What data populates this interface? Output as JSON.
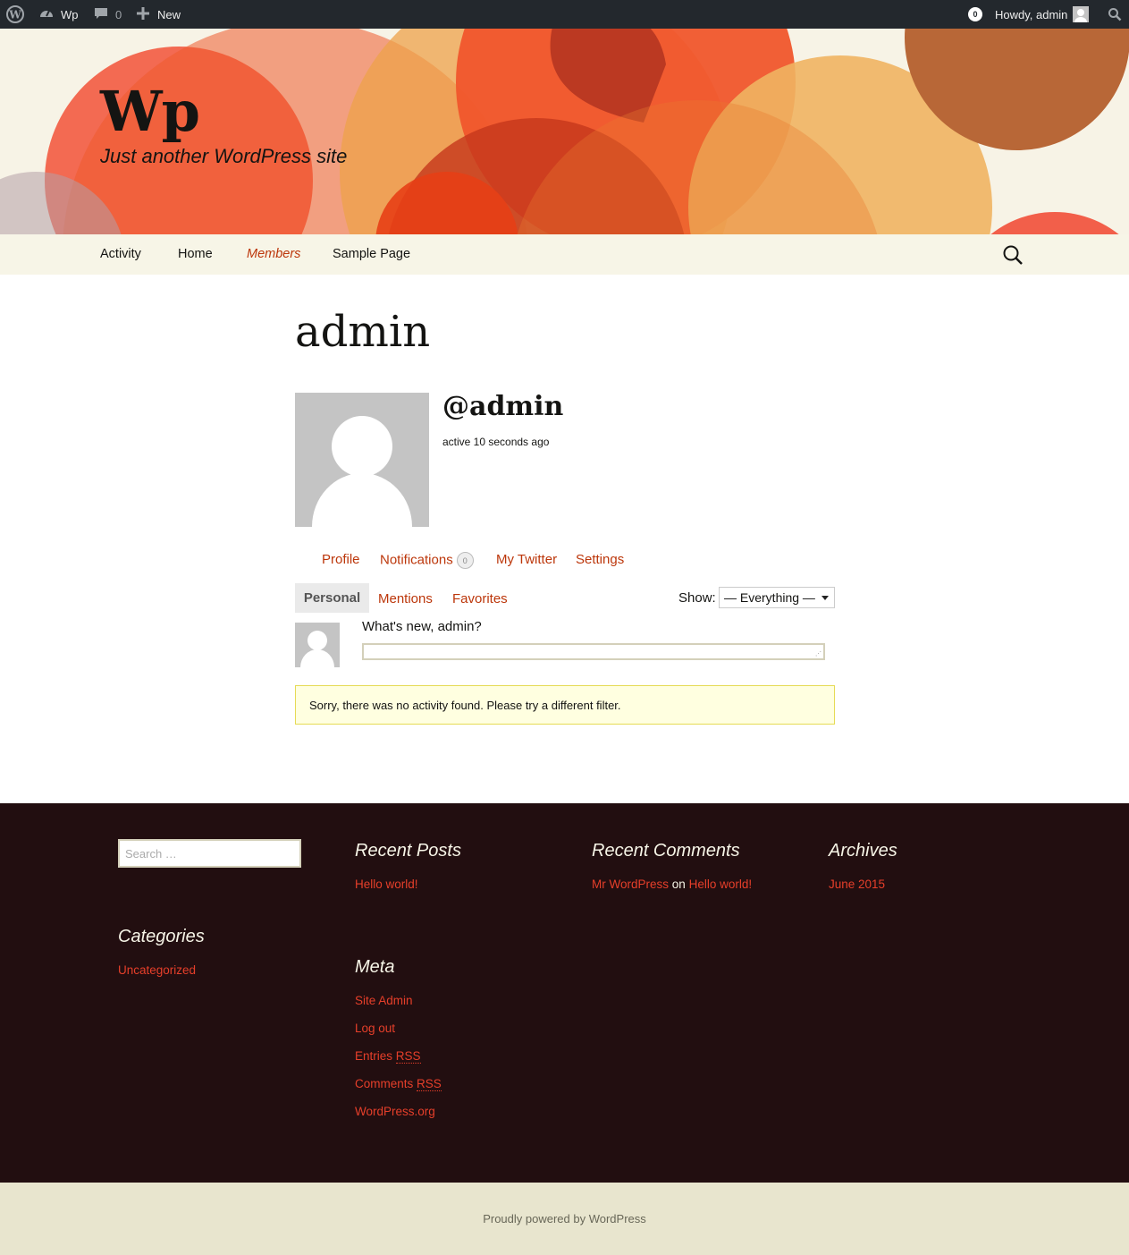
{
  "admin_bar": {
    "site_name": "Wp",
    "comments_count": "0",
    "new_label": "New",
    "notifications_count": "0",
    "howdy": "Howdy, admin",
    "icons": [
      "wordpress-logo-icon",
      "dashboard-icon",
      "comment-icon",
      "plus-icon",
      "user-avatar-icon",
      "search-icon"
    ]
  },
  "header": {
    "site_title": "Wp",
    "tagline": "Just another WordPress site"
  },
  "nav": {
    "items": [
      "Activity",
      "Home",
      "Members",
      "Sample Page"
    ],
    "current": "Members"
  },
  "profile": {
    "page_title": "admin",
    "mention": "@admin",
    "last_active": "active 10 seconds ago",
    "tabs": [
      "Profile",
      "Notifications",
      "My Twitter",
      "Settings"
    ],
    "notifications_count": "0",
    "subtabs": [
      "Personal",
      "Mentions",
      "Favorites"
    ],
    "show_label": "Show:",
    "show_value": "— Everything —",
    "whats_new": "What's new, admin?",
    "notice": "Sorry, there was no activity found. Please try a different filter."
  },
  "footer": {
    "search_placeholder": "Search …",
    "recent_posts_title": "Recent Posts",
    "recent_posts": [
      "Hello world!"
    ],
    "recent_comments_title": "Recent Comments",
    "comment_author": "Mr WordPress",
    "comment_on": "on",
    "comment_post": "Hello world!",
    "archives_title": "Archives",
    "archives": [
      "June 2015"
    ],
    "categories_title": "Categories",
    "categories": [
      "Uncategorized"
    ],
    "meta_title": "Meta",
    "meta_links": [
      "Site Admin",
      "Log out",
      "Entries",
      "Comments",
      "WordPress.org"
    ],
    "rss_abbr": "RSS",
    "powered_by": "Proudly powered by WordPress"
  },
  "colors": {
    "accent": "#bc360a",
    "footer_bg": "#220e10",
    "footer_link": "#e63f2a",
    "admin_bar_bg": "#23282d",
    "notice_bg": "#ffffe0"
  }
}
